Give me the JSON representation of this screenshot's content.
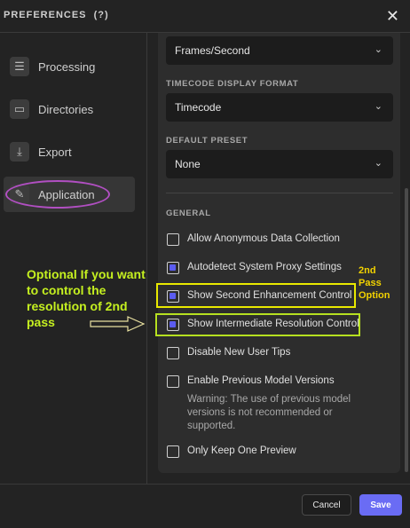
{
  "header": {
    "title": "PREFERENCES",
    "help": "(?)",
    "close_icon": "close-icon"
  },
  "sidebar": {
    "items": [
      {
        "label": "Processing",
        "icon": "sliders-icon"
      },
      {
        "label": "Directories",
        "icon": "folder-icon"
      },
      {
        "label": "Export",
        "icon": "download-icon"
      },
      {
        "label": "Application",
        "icon": "edit-icon"
      }
    ]
  },
  "main": {
    "frame_select": {
      "value": "Frames/Second"
    },
    "timecode": {
      "label": "TIMECODE DISPLAY FORMAT",
      "value": "Timecode"
    },
    "preset": {
      "label": "DEFAULT PRESET",
      "value": "None"
    },
    "general": {
      "label": "GENERAL",
      "options": [
        {
          "label": "Allow Anonymous Data Collection",
          "checked": false
        },
        {
          "label": "Autodetect System Proxy Settings",
          "checked": true
        },
        {
          "label": "Show Second Enhancement Control",
          "checked": true
        },
        {
          "label": "Show Intermediate Resolution Control",
          "checked": true
        },
        {
          "label": "Disable New User Tips",
          "checked": false
        },
        {
          "label": "Enable Previous Model Versions",
          "checked": false
        },
        {
          "label": "Only Keep One Preview",
          "checked": false
        }
      ],
      "warning": "Warning: The use of previous model versions is not recommended or supported."
    }
  },
  "annotations": {
    "left_text": "Optional If you want to control the resolution of 2nd pass",
    "right_text_line1": "2nd",
    "right_text_line2": "Pass",
    "right_text_line3": "Option"
  },
  "footer": {
    "cancel_label": "Cancel",
    "save_label": "Save"
  },
  "colors": {
    "accent": "#6a6cf4",
    "annotation_yellow": "#f2d200",
    "annotation_green": "#c5f020",
    "ellipse": "#b14fc2"
  }
}
